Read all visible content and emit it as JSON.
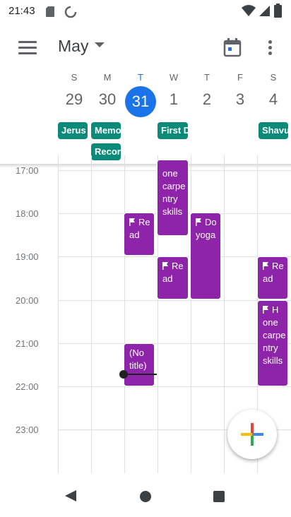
{
  "status_bar": {
    "time": "21:43",
    "icons": [
      "sd-card-icon",
      "data-saver-icon",
      "wifi-icon",
      "cell-signal-icon",
      "battery-icon"
    ]
  },
  "app_bar": {
    "menu_icon": "hamburger-menu-icon",
    "month_label": "May",
    "today_icon": "calendar-today-icon",
    "overflow_icon": "more-vert-icon"
  },
  "week": {
    "days": [
      {
        "dow": "S",
        "date": "29",
        "today": false
      },
      {
        "dow": "M",
        "date": "30",
        "today": false
      },
      {
        "dow": "T",
        "date": "31",
        "today": true
      },
      {
        "dow": "W",
        "date": "1",
        "today": false
      },
      {
        "dow": "T",
        "date": "2",
        "today": false
      },
      {
        "dow": "F",
        "date": "3",
        "today": false
      },
      {
        "dow": "S",
        "date": "4",
        "today": false
      }
    ],
    "all_day_events": [
      {
        "day": "S 29",
        "label": "Jerus"
      },
      {
        "day": "M 30",
        "label": "Memo"
      },
      {
        "day": "M 30",
        "label": "Recor"
      },
      {
        "day": "W 1",
        "label": "First D"
      },
      {
        "day": "S 4",
        "label": "Shavu"
      }
    ]
  },
  "hours": [
    "17:00",
    "18:00",
    "19:00",
    "20:00",
    "21:00",
    "22:00",
    "23:00"
  ],
  "events": [
    {
      "day": "W 1",
      "title": "one carpentry skills",
      "lines": [
        "one",
        "carpe",
        "ntry",
        "skills"
      ],
      "has_flag": false
    },
    {
      "day": "T 31",
      "title": "Read",
      "lines": [
        "Re",
        "ad"
      ],
      "has_flag": true
    },
    {
      "day": "T 2",
      "title": "Do yoga",
      "lines": [
        "Do",
        "yoga"
      ],
      "has_flag": true
    },
    {
      "day": "W 1",
      "title": "Read",
      "lines": [
        "Re",
        "ad"
      ],
      "has_flag": true
    },
    {
      "day": "S 4",
      "title": "Read",
      "lines": [
        "Re",
        "ad"
      ],
      "has_flag": true
    },
    {
      "day": "S 4",
      "title": "Hone carpentry skills",
      "lines": [
        "H",
        "one",
        "carpe",
        "ntry",
        "skills"
      ],
      "has_flag": true
    },
    {
      "day": "T 31",
      "title": "(No title)",
      "lines": [
        "(No",
        "title)"
      ],
      "has_flag": false
    }
  ],
  "fab": {
    "icon": "add-plus-icon"
  },
  "nav_bar": {
    "icons": [
      "back-icon",
      "home-icon",
      "recents-icon"
    ]
  },
  "colors": {
    "event_purple": "#8e24aa",
    "holiday_green": "#0b8a79",
    "today_blue": "#1a73e8"
  }
}
